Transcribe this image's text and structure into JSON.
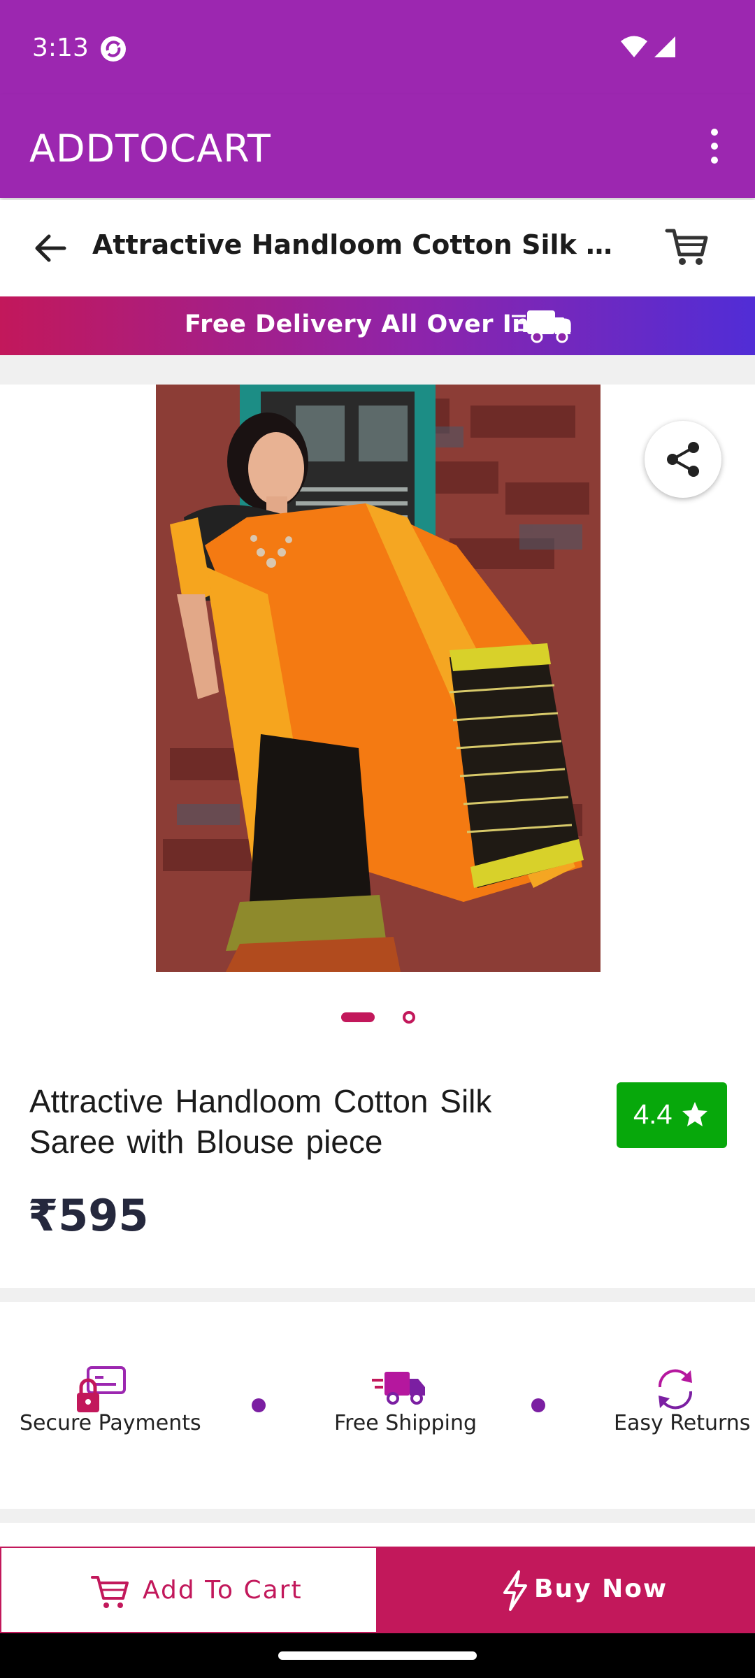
{
  "status_bar": {
    "time": "3:13"
  },
  "app_bar": {
    "title": "ADDTOCART"
  },
  "product_header": {
    "title": "Attractive Handloom Cotton Silk Sare..."
  },
  "banner": {
    "text": "Free Delivery All Over India"
  },
  "gallery": {
    "image_count": 2,
    "active_index": 0
  },
  "product": {
    "title": "Attractive Handloom Cotton Silk Saree with Blouse piece",
    "rating": "4.4",
    "price": "₹595"
  },
  "features": [
    {
      "label": "Secure Payments",
      "icon": "secure-payment-icon"
    },
    {
      "label": "Free Shipping",
      "icon": "delivery-truck-icon"
    },
    {
      "label": "Easy Returns",
      "icon": "refresh-icon"
    }
  ],
  "actions": {
    "add_to_cart": "Add To Cart",
    "buy_now": "Buy Now"
  },
  "colors": {
    "primary": "#9c27b0",
    "accent": "#c2185b",
    "rating_green": "#07a80b",
    "banner_gradient": [
      "#c2185b",
      "#512dd6"
    ]
  }
}
